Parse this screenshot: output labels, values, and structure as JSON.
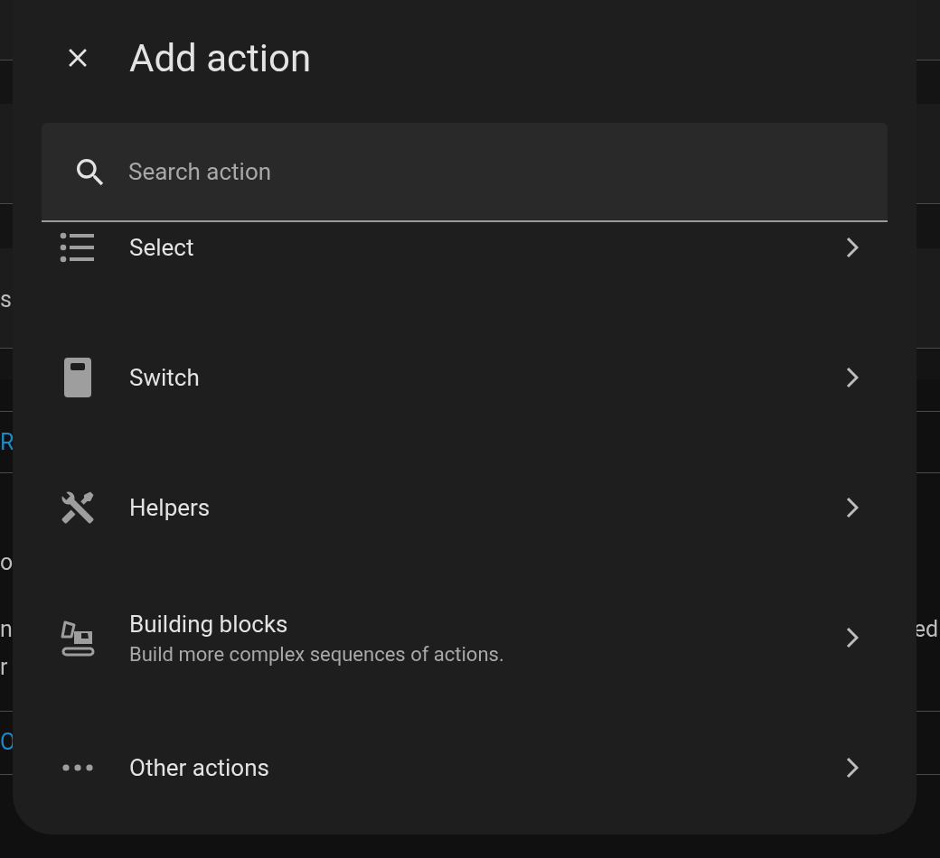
{
  "background": {
    "left_fragments": [
      {
        "text": "s",
        "kind": "text"
      },
      {
        "text": "R",
        "kind": "link"
      },
      {
        "text": "o",
        "kind": "text"
      },
      {
        "text": "n",
        "kind": "text"
      },
      {
        "text": "r",
        "kind": "text"
      },
      {
        "text": "O",
        "kind": "link"
      }
    ],
    "right_fragments": [
      "ed"
    ]
  },
  "dialog": {
    "title": "Add action",
    "search": {
      "placeholder": "Search action"
    },
    "items": [
      {
        "label": "Select"
      },
      {
        "label": "Switch"
      },
      {
        "label": "Helpers"
      },
      {
        "label": "Building blocks",
        "description": "Build more complex sequences of actions."
      },
      {
        "label": "Other actions"
      }
    ]
  }
}
